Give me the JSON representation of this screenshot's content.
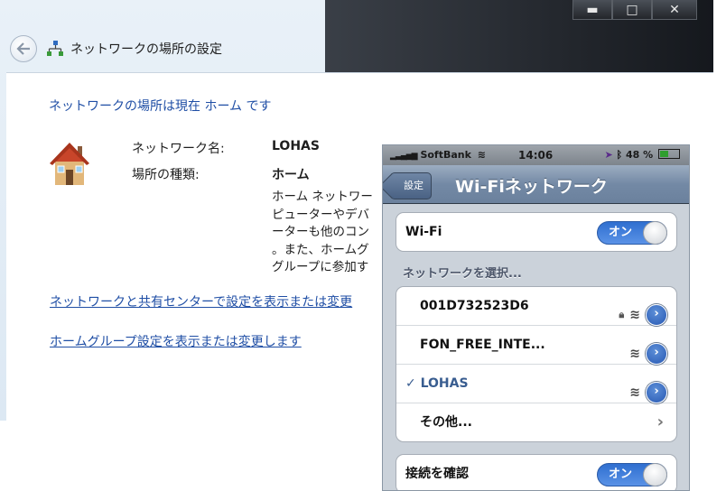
{
  "window": {
    "title": "ネットワークの場所の設定",
    "buttons": {
      "minimize": "▬",
      "maximize": "□",
      "close": "✕"
    }
  },
  "main": {
    "location_line": "ネットワークの場所は現在 ホーム です",
    "network_name_label": "ネットワーク名:",
    "network_name_value": "LOHAS",
    "location_type_label": "場所の種類:",
    "location_type_value": "ホーム",
    "description_lines": [
      "ホーム ネットワー",
      "ピューターやデバ",
      "ーターも他のコン",
      "。また、ホームグ",
      "グループに参加す"
    ],
    "link_network_center": "ネットワークと共有センターで設定を表示または変更",
    "link_homegroup": "ホームグループ設定を表示または変更します"
  },
  "phone": {
    "status": {
      "carrier": "SoftBank",
      "time": "14:06",
      "battery": "48 %"
    },
    "nav": {
      "back_label": "設定",
      "title": "Wi-Fiネットワーク"
    },
    "wifi_row": {
      "label": "Wi-Fi",
      "toggle": "オン"
    },
    "section_header": "ネットワークを選択...",
    "networks": [
      {
        "name": "001D732523D6",
        "locked": true
      },
      {
        "name": "FON_FREE_INTE...",
        "locked": false
      },
      {
        "name": "LOHAS",
        "checked": true,
        "locked": false
      }
    ],
    "other_label": "その他...",
    "ask_row": {
      "label": "接続を確認",
      "toggle": "オン"
    }
  },
  "colors": {
    "link_blue": "#1f4ea5",
    "ios_blue": "#2f6fd0",
    "nav_bar": "#7389a5"
  }
}
